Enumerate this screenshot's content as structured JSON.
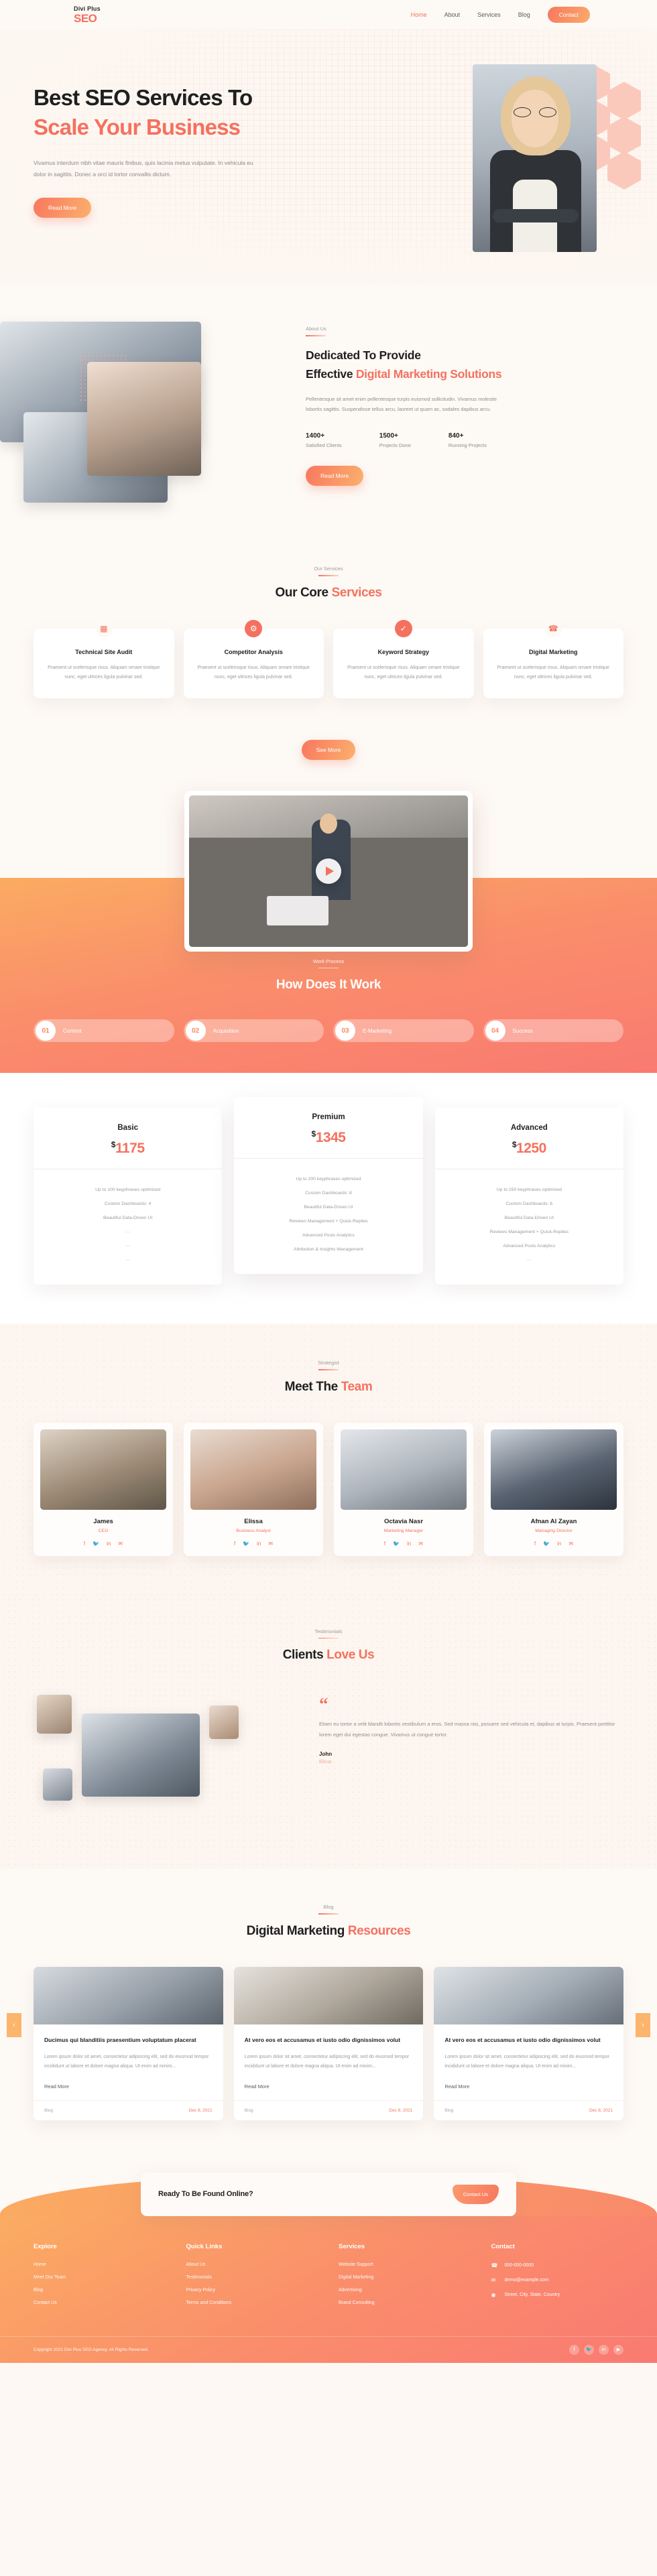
{
  "header": {
    "logo_top": "Divi Plus",
    "logo_main": "SEO",
    "nav": [
      {
        "label": "Home",
        "active": true
      },
      {
        "label": "About",
        "active": false
      },
      {
        "label": "Services",
        "active": false
      },
      {
        "label": "Blog",
        "active": false
      }
    ],
    "contact_button": "Contact"
  },
  "hero": {
    "title_line1": "Best SEO Services To",
    "title_line2": "Scale Your Business",
    "paragraph": "Vivamus interdum nibh vitae mauris finibus, quis lacinia metus vulputate. In vehicula eu dolor in sagittis. Donec a orci id tortor convallis dictum.",
    "button": "Read More"
  },
  "about": {
    "eyebrow": "About Us",
    "title_1": "Dedicated To Provide",
    "title_2": "Effective ",
    "title_accent": "Digital Marketing Solutions",
    "paragraph": "Pellentesque sit amet enim pellentesque turpis euismod sollicitudin. Vivamus molestie lobortis sagittis. Suspendisse tellus arcu, laoreet ut quam ac, sodales dapibus arcu.",
    "stats": [
      {
        "number": "1400+",
        "label": "Satisfied Clients"
      },
      {
        "number": "1500+",
        "label": "Projects Done"
      },
      {
        "number": "840+",
        "label": "Running Projects"
      }
    ],
    "button": "Read More"
  },
  "services": {
    "eyebrow": "Our Services",
    "title_plain": "Our Core ",
    "title_accent": "Services",
    "cards": [
      {
        "icon": "calendar-icon",
        "glyph": "▦",
        "title": "Technical Site Audit",
        "text": "Praesent ut scelerisque risus. Aliquam ornare tristique nunc, eget ultrices ligula pulvinar sed."
      },
      {
        "icon": "brain-gear-icon",
        "glyph": "⚙",
        "title": "Competitor Analysis",
        "text": "Praesent ut scelerisque risus. Aliquam ornare tristique nunc, eget ultrices ligula pulvinar sed."
      },
      {
        "icon": "check-circle-icon",
        "glyph": "✓",
        "title": "Keyword Strategy",
        "text": "Praesent ut scelerisque risus. Aliquam ornare tristique nunc, eget ultrices ligula pulvinar sed."
      },
      {
        "icon": "headset-icon",
        "glyph": "☎",
        "title": "Digital Marketing",
        "text": "Praesent ut scelerisque risus. Aliquam ornare tristique nunc, eget ultrices ligula pulvinar sed."
      }
    ],
    "button": "See More"
  },
  "process": {
    "eyebrow": "Work Process",
    "title": "How Does It Work",
    "steps": [
      {
        "num": "01",
        "label": "Content"
      },
      {
        "num": "02",
        "label": "Acquisition"
      },
      {
        "num": "03",
        "label": "E-Marketing"
      },
      {
        "num": "04",
        "label": "Success"
      }
    ],
    "play_icon": "play-icon"
  },
  "pricing": {
    "plans": [
      {
        "name": "Basic",
        "currency": "$",
        "price": "1175",
        "features": [
          {
            "text": "Up to 100 keyphrases optimized",
            "dash": false
          },
          {
            "text": "Custom Dashboards: 4",
            "dash": false
          },
          {
            "text": "Beautiful Data-Driven UI",
            "dash": false
          },
          {
            "text": "—",
            "dash": true
          },
          {
            "text": "—",
            "dash": true
          },
          {
            "text": "—",
            "dash": true
          }
        ]
      },
      {
        "name": "Premium",
        "currency": "$",
        "price": "1345",
        "features": [
          {
            "text": "Up to 200 keyphrases optimized",
            "dash": false
          },
          {
            "text": "Custom Dashboards: 8",
            "dash": false
          },
          {
            "text": "Beautiful Data-Driven UI",
            "dash": false
          },
          {
            "text": "Reviews Management + Quick-Replies",
            "dash": false
          },
          {
            "text": "Advanced Posts Analytics",
            "dash": false
          },
          {
            "text": "Attribution & Insights Management",
            "dash": false
          }
        ]
      },
      {
        "name": "Advanced",
        "currency": "$",
        "price": "1250",
        "features": [
          {
            "text": "Up to 150 keyphrases optimized",
            "dash": false
          },
          {
            "text": "Custom Dashboards: 6",
            "dash": false
          },
          {
            "text": "Beautiful Data-Driven UI",
            "dash": false
          },
          {
            "text": "Reviews Management + Quick-Replies",
            "dash": false
          },
          {
            "text": "Advanced Posts Analytics",
            "dash": false
          },
          {
            "text": "—",
            "dash": true
          }
        ]
      }
    ]
  },
  "team": {
    "eyebrow": "Strategist",
    "title_plain": "Meet The ",
    "title_accent": "Team",
    "members": [
      {
        "name": "James",
        "role": "CEO"
      },
      {
        "name": "Elissa",
        "role": "Business Analyst"
      },
      {
        "name": "Octavia Nasr",
        "role": "Marketing Manager"
      },
      {
        "name": "Afnan Al Zayan",
        "role": "Managing Director"
      }
    ],
    "social": [
      "f",
      "🐦",
      "in",
      "✉"
    ]
  },
  "testimonials": {
    "eyebrow": "Testimonials",
    "title_plain": "Clients ",
    "title_accent": "Love Us",
    "quote_mark": "“",
    "text": "Etiam eu tortor a velit blandit lobortis vestibulum a eros. Sed massa nisi, posuere sed vehicula et, dapibus at turpis. Praesent porttitor lorem eget dui egestas congue. Vivamus ut congue tortor.",
    "author": "John",
    "company": "Elicus"
  },
  "blog": {
    "eyebrow": "Blog",
    "title_plain": "Digital Marketing ",
    "title_accent": "Resources",
    "posts": [
      {
        "title": "Ducimus qui blanditiis praesentium voluptatum placerat",
        "excerpt": "Lorem ipsum dolor sit amet, consectetur adipiscing elit, sed do eiusmod tempor incididunt ut labore et dolore magna aliqua. Ut enim ad minim...",
        "read_more": "Read More",
        "category": "Blog",
        "date": "Dec 8, 2021"
      },
      {
        "title": "At vero eos et accusamus et iusto odio dignissimos volut",
        "excerpt": "Lorem ipsum dolor sit amet, consectetur adipiscing elit, sed do eiusmod tempor incididunt ut labore et dolore magna aliqua. Ut enim ad minim...",
        "read_more": "Read More",
        "category": "Blog",
        "date": "Dec 8, 2021"
      },
      {
        "title": "At vero eos et accusamus et iusto odio dignissimos volut",
        "excerpt": "Lorem ipsum dolor sit amet, consectetur adipiscing elit, sed do eiusmod tempor incididunt ut labore et dolore magna aliqua. Ut enim ad minim...",
        "read_more": "Read More",
        "category": "Blog",
        "date": "Dec 8, 2021"
      }
    ],
    "prev_arrow": "‹",
    "next_arrow": "›"
  },
  "cta": {
    "text": "Ready To Be Found Online?",
    "button": "Contact Us"
  },
  "footer": {
    "columns": [
      {
        "heading": "Explore",
        "links": [
          "Home",
          "Meet Our Team",
          "Blog",
          "Contact Us"
        ]
      },
      {
        "heading": "Quick Links",
        "links": [
          "About Us",
          "Testimonials",
          "Privacy Policy",
          "Terms and Conditions"
        ]
      },
      {
        "heading": "Services",
        "links": [
          "Website Support",
          "Digital Marketing",
          "Advertising",
          "Brand Consulting"
        ]
      }
    ],
    "contact_heading": "Contact",
    "contact": [
      {
        "icon": "phone-icon",
        "glyph": "☎",
        "text": "000-000-0000"
      },
      {
        "icon": "mail-icon",
        "glyph": "✉",
        "text": "demo@example.com"
      },
      {
        "icon": "location-icon",
        "glyph": "◉",
        "text": "Street, City, State, Country"
      }
    ],
    "copyright": "Copyright 2021 Divi Plus SEO Agency. All Rights Reserved.",
    "social": [
      "f",
      "🐦",
      "in",
      "▶"
    ]
  },
  "colors": {
    "accent": "#f4715f",
    "gradient_start": "#fbab62",
    "gradient_end": "#f97a71",
    "page_bg": "#fdf9f5"
  }
}
